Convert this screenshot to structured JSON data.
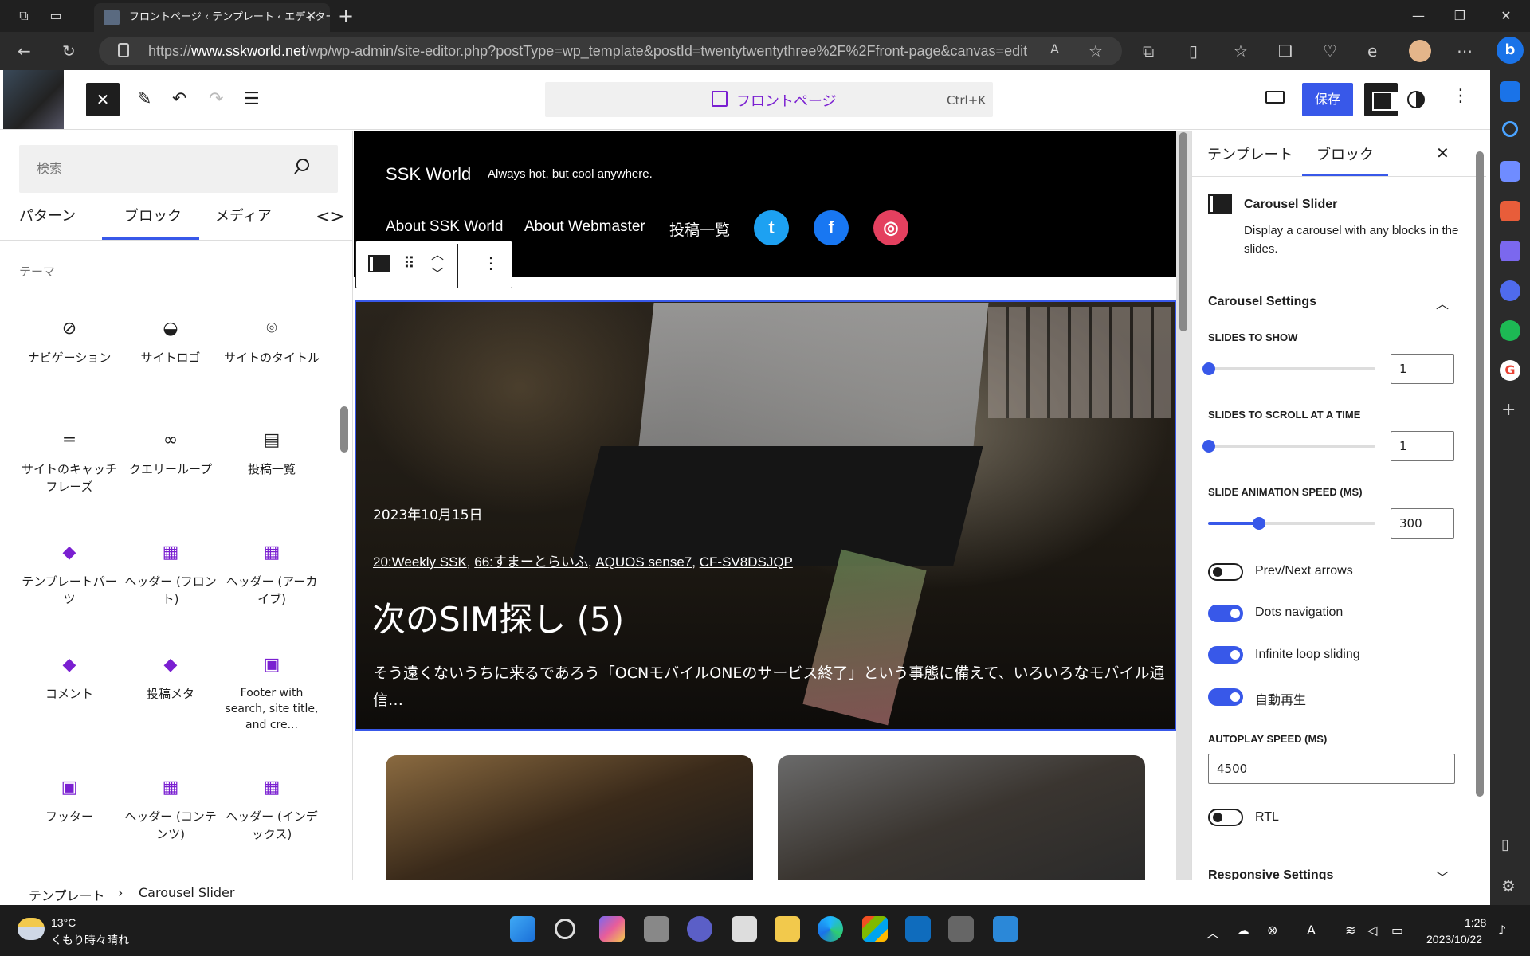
{
  "browser": {
    "tab_title": "フロントページ ‹ テンプレート ‹ エディター",
    "url_prefix": "https://",
    "url_host": "www.sskworld.net",
    "url_path": "/wp/wp-admin/site-editor.php?postType=wp_template&postId=twentytwentythree%2F%2Ffront-page&canvas=edit"
  },
  "editor_header": {
    "doc_title": "フロントページ",
    "shortcut": "Ctrl+K",
    "save_label": "保存"
  },
  "inserter": {
    "search_placeholder": "検索",
    "tabs": [
      "パターン",
      "ブロック",
      "メディア"
    ],
    "category": "テーマ",
    "blocks": [
      {
        "label": "ナビゲーション",
        "icon": "navigation-icon"
      },
      {
        "label": "サイトロゴ",
        "icon": "site-logo-icon"
      },
      {
        "label": "サイトのタイトル",
        "icon": "map-marker-icon"
      },
      {
        "label": "サイトのキャッチフレーズ",
        "icon": "tagline-icon"
      },
      {
        "label": "クエリーループ",
        "icon": "loop-icon"
      },
      {
        "label": "投稿一覧",
        "icon": "post-list-icon"
      },
      {
        "label": "テンプレートパーツ",
        "icon": "template-part-icon"
      },
      {
        "label": "ヘッダー (フロント)",
        "icon": "header-icon"
      },
      {
        "label": "ヘッダー (アーカイブ)",
        "icon": "header-icon"
      },
      {
        "label": "コメント",
        "icon": "template-part-icon"
      },
      {
        "label": "投稿メタ",
        "icon": "template-part-icon"
      },
      {
        "label": "Footer with search, site title, and cre...",
        "icon": "footer-icon"
      },
      {
        "label": "フッター",
        "icon": "footer-icon"
      },
      {
        "label": "ヘッダー (コンテンツ)",
        "icon": "header-icon"
      },
      {
        "label": "ヘッダー (インデックス)",
        "icon": "header-icon"
      }
    ]
  },
  "site": {
    "title": "SSK World",
    "tagline": "Always hot, but cool anywhere.",
    "nav": [
      "About SSK World",
      "About Webmaster",
      "投稿一覧"
    ]
  },
  "slide": {
    "date": "2023年10月15日",
    "categories": [
      "20:Weekly SSK",
      "66:すまーとらいふ",
      "AQUOS sense7",
      "CF-SV8DSJQP"
    ],
    "title": "次のSIM探し (5)",
    "excerpt": "そう遠くないうちに来るであろう「OCNモバイルONEのサービス終了」という事態に備えて、いろいろなモバイル通信…"
  },
  "settings": {
    "tabs": [
      "テンプレート",
      "ブロック"
    ],
    "block_name": "Carousel Slider",
    "block_desc": "Display a carousel with any blocks in the slides.",
    "section_title": "Carousel Settings",
    "slides_to_show_label": "SLIDES TO SHOW",
    "slides_to_show": "1",
    "slides_to_scroll_label": "SLIDES TO SCROLL AT A TIME",
    "slides_to_scroll": "1",
    "anim_speed_label": "SLIDE ANIMATION SPEED (MS)",
    "anim_speed": "300",
    "toggles": [
      {
        "label": "Prev/Next arrows",
        "on": false
      },
      {
        "label": "Dots navigation",
        "on": true
      },
      {
        "label": "Infinite loop sliding",
        "on": true
      },
      {
        "label": "自動再生",
        "on": true
      }
    ],
    "autoplay_label": "AUTOPLAY SPEED (MS)",
    "autoplay_speed": "4500",
    "rtl_label": "RTL",
    "rtl_on": false,
    "responsive_title": "Responsive Settings"
  },
  "breadcrumb": [
    "テンプレート",
    "Carousel Slider"
  ],
  "taskbar": {
    "temp": "13°C",
    "weather": "くもり時々晴れ",
    "time": "1:28",
    "date": "2023/10/22"
  }
}
